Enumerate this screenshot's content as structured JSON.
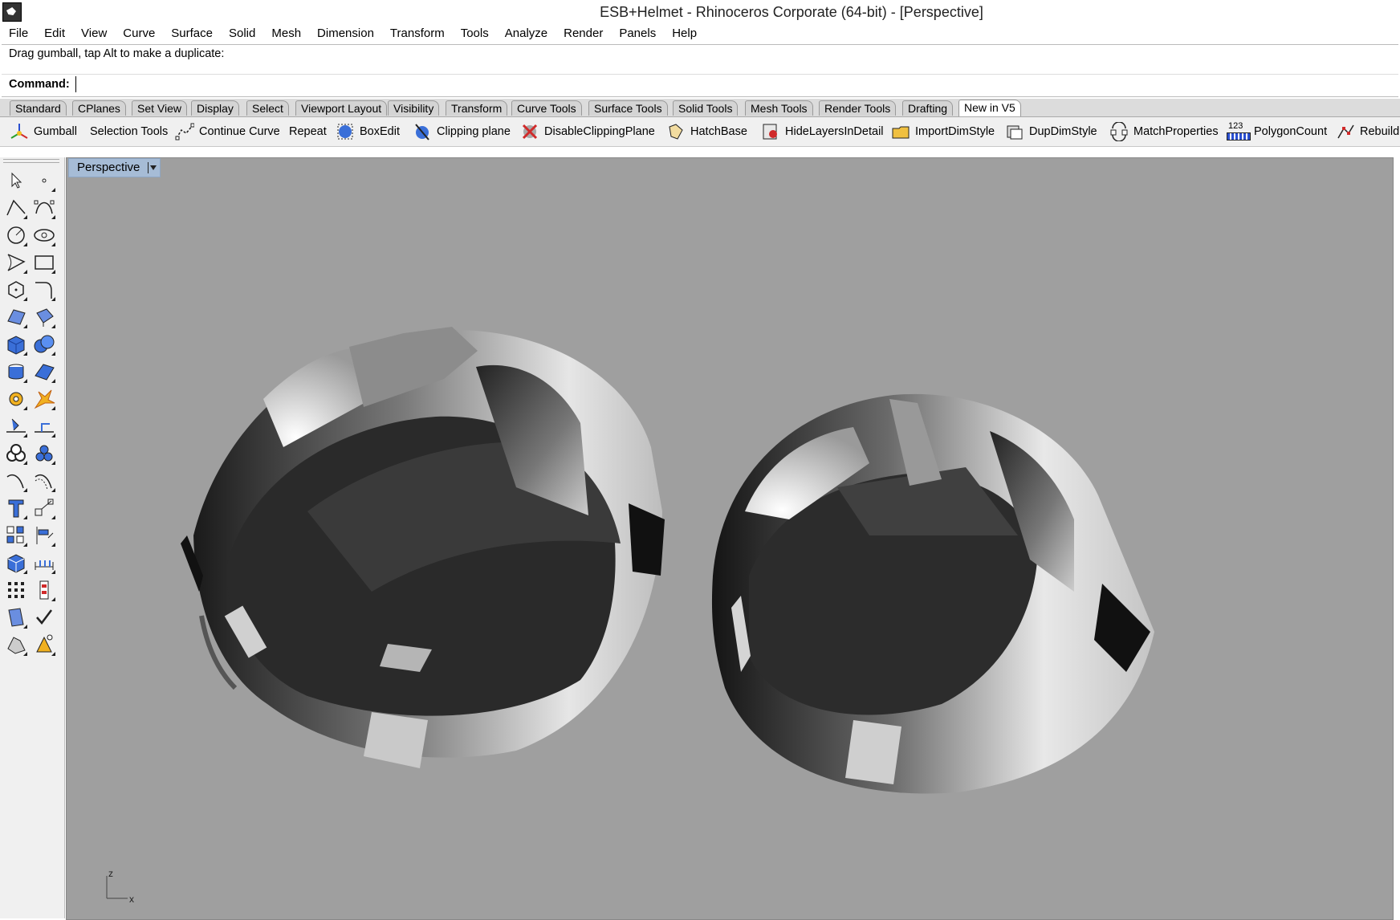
{
  "window": {
    "title": "ESB+Helmet - Rhinoceros Corporate (64-bit) - [Perspective]"
  },
  "menubar": {
    "items": [
      "File",
      "Edit",
      "View",
      "Curve",
      "Surface",
      "Solid",
      "Mesh",
      "Dimension",
      "Transform",
      "Tools",
      "Analyze",
      "Render",
      "Panels",
      "Help"
    ]
  },
  "command": {
    "history": "Drag gumball, tap Alt to make a duplicate:",
    "label": "Command:",
    "value": ""
  },
  "tabs": {
    "items": [
      "Standard",
      "CPlanes",
      "Set View",
      "Display",
      "Select",
      "Viewport Layout",
      "Visibility",
      "Transform",
      "Curve Tools",
      "Surface Tools",
      "Solid Tools",
      "Mesh Tools",
      "Render Tools",
      "Drafting",
      "New in V5"
    ],
    "active": "New in V5"
  },
  "toolbar": {
    "items": [
      "Gumball",
      "Selection Tools",
      "Continue Curve",
      "Repeat",
      "BoxEdit",
      "Clipping plane",
      "DisableClippingPlane",
      "HatchBase",
      "HideLayersInDetail",
      "ImportDimStyle",
      "DupDimStyle",
      "MatchProperties",
      "PolygonCount",
      "Rebuild"
    ],
    "polygon_count_badge": "123"
  },
  "viewport": {
    "label": "Perspective",
    "axis_x": "x",
    "axis_z": "z"
  },
  "sidebar": {
    "tools": [
      "select-arrow",
      "point",
      "polyline",
      "curve-edit",
      "circle",
      "ellipse",
      "arc",
      "rectangle",
      "polygon",
      "fillet-curves",
      "surface-from-points",
      "extrude-surface",
      "box",
      "boolean-solids",
      "cylinder-tools",
      "planar-surface",
      "solid-edit",
      "explode",
      "split",
      "trim",
      "boolean-union",
      "spheres",
      "curve-from-object",
      "offset-curve",
      "text",
      "scale",
      "array",
      "align",
      "mesh-box",
      "dimension",
      "grid-array",
      "layer-list",
      "clipboard",
      "check",
      "render-object",
      "light"
    ]
  },
  "colors": {
    "viewport_bg": "#9f9f9f",
    "viewport_label_bg": "#a6bcd6",
    "toolbar_bg": "#f0f0f0",
    "window_bg": "#ffffff"
  }
}
